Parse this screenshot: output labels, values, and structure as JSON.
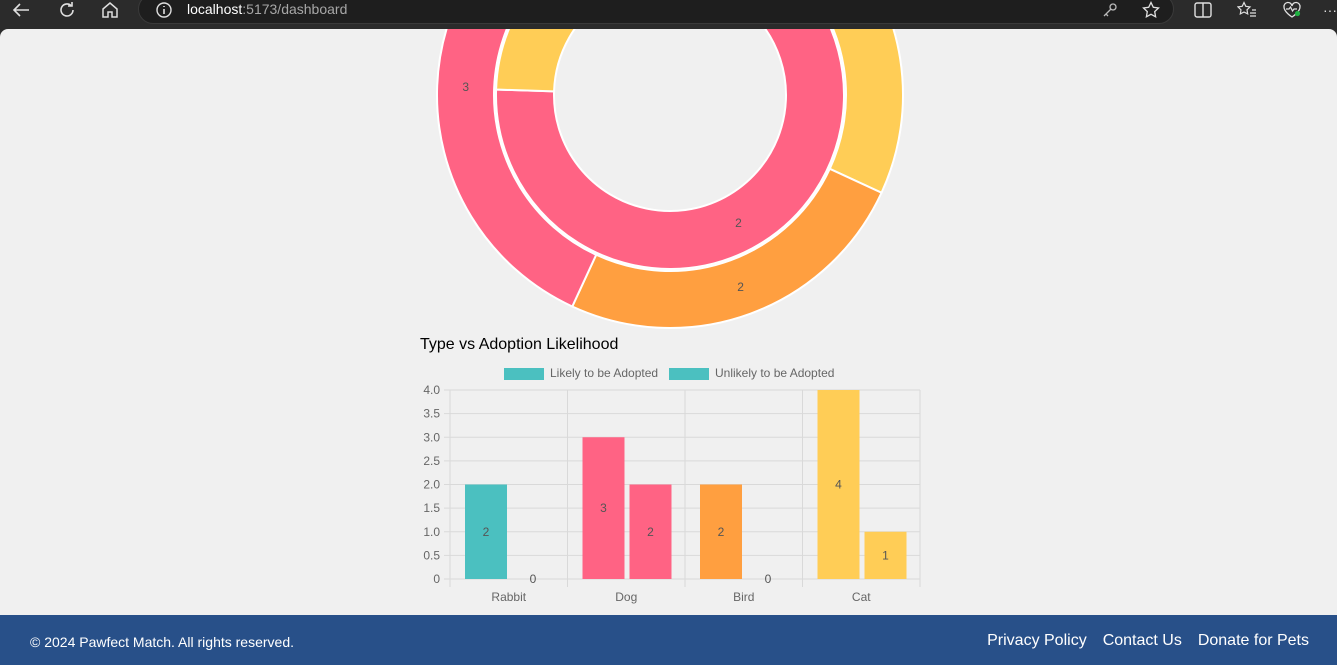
{
  "browser": {
    "url_host": "localhost",
    "url_rest": ":5173/dashboard"
  },
  "donut": {
    "outer": [
      {
        "value": 3,
        "color": "#FFCD56",
        "label": ""
      },
      {
        "value": 2,
        "color": "#FF9F40",
        "label": "2"
      },
      {
        "value": 3,
        "color": "#FF6384",
        "label": "3"
      }
    ],
    "inner": [
      {
        "value": 0,
        "color": "#FF9F40",
        "label": "0"
      },
      {
        "value": 2,
        "color": "#FF6384",
        "label": "2"
      },
      {
        "value": 1,
        "color": "#FFCD56",
        "label": ""
      }
    ]
  },
  "chart_data": {
    "type": "bar",
    "title": "Type vs Adoption Likelihood",
    "categories": [
      "Rabbit",
      "Dog",
      "Bird",
      "Cat"
    ],
    "series": [
      {
        "name": "Likely to be Adopted",
        "values": [
          2,
          3,
          2,
          4
        ],
        "legend_color": "#4BC0C0"
      },
      {
        "name": "Unlikely to be Adopted",
        "values": [
          0,
          2,
          0,
          1
        ],
        "legend_color": "#4BC0C0"
      }
    ],
    "bar_colors": [
      "#4BC0C0",
      "#FF6384",
      "#FF9F40",
      "#FFCD56"
    ],
    "y_ticks": [
      "0",
      "0.5",
      "1.0",
      "1.5",
      "2.0",
      "2.5",
      "3.0",
      "3.5",
      "4.0"
    ],
    "ylim": [
      0,
      4
    ],
    "grid": true,
    "legend_position": "top"
  },
  "footer": {
    "copyright": "© 2024 Pawfect Match. All rights reserved.",
    "links": [
      "Privacy Policy",
      "Contact Us",
      "Donate for Pets"
    ]
  }
}
